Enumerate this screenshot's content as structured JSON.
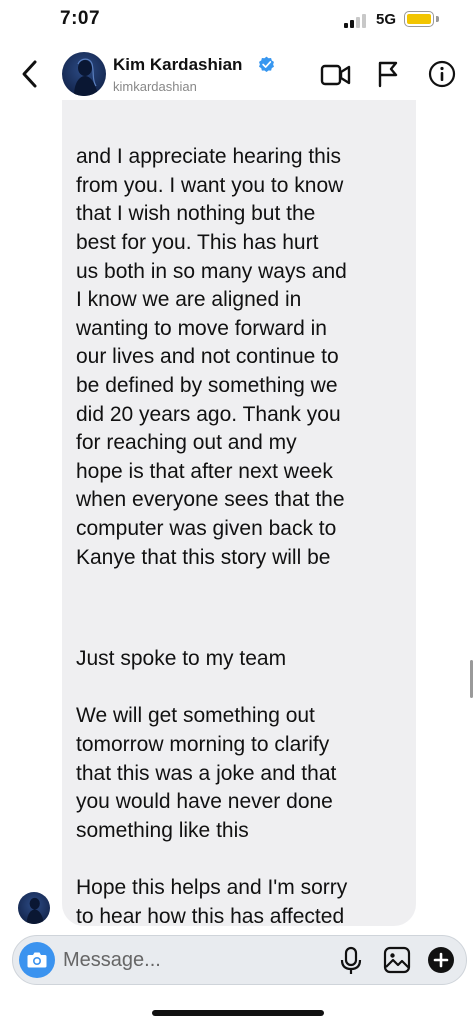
{
  "status_bar": {
    "time": "7:07",
    "network": "5G",
    "battery_color": "#f2c500"
  },
  "header": {
    "back_icon": "chevron-left-icon",
    "contact_name": "Kim Kardashian",
    "contact_handle": "kimkardashian",
    "verified": true,
    "verified_color": "#3897f0",
    "actions": [
      "video-call-icon",
      "flag-icon",
      "info-icon"
    ]
  },
  "messages": [
    {
      "sender": "kimkardashian",
      "text": "and I appreciate hearing this\nfrom you. I want you to know\nthat I wish nothing but the\nbest for you. This has hurt\nus both in so many ways and\nI know we are aligned in\nwanting to move forward in\nour lives and not continue to\nbe defined by something we\ndid 20 years ago. Thank you\nfor reaching out and my\nhope is that after next week\nwhen everyone sees that the\ncomputer was given back to\nKanye that this story will be\ndead and done with."
    },
    {
      "sender": "kimkardashian",
      "text": "Just spoke to my team\n\nWe will get something out\ntomorrow morning to clarify\nthat this was a joke and that\nyou would have never done\nsomething like this\n\nHope this helps and I'm sorry\nto hear how this has affected\nyou — it wasn't my intention"
    }
  ],
  "composer": {
    "placeholder": "Message...",
    "camera_color": "#3b93ef",
    "icons": [
      "camera-icon",
      "microphone-icon",
      "gallery-icon",
      "plus-icon"
    ]
  },
  "colors": {
    "bubble_bg": "#efeff1",
    "avatar_bg": "#1a2f5e"
  }
}
